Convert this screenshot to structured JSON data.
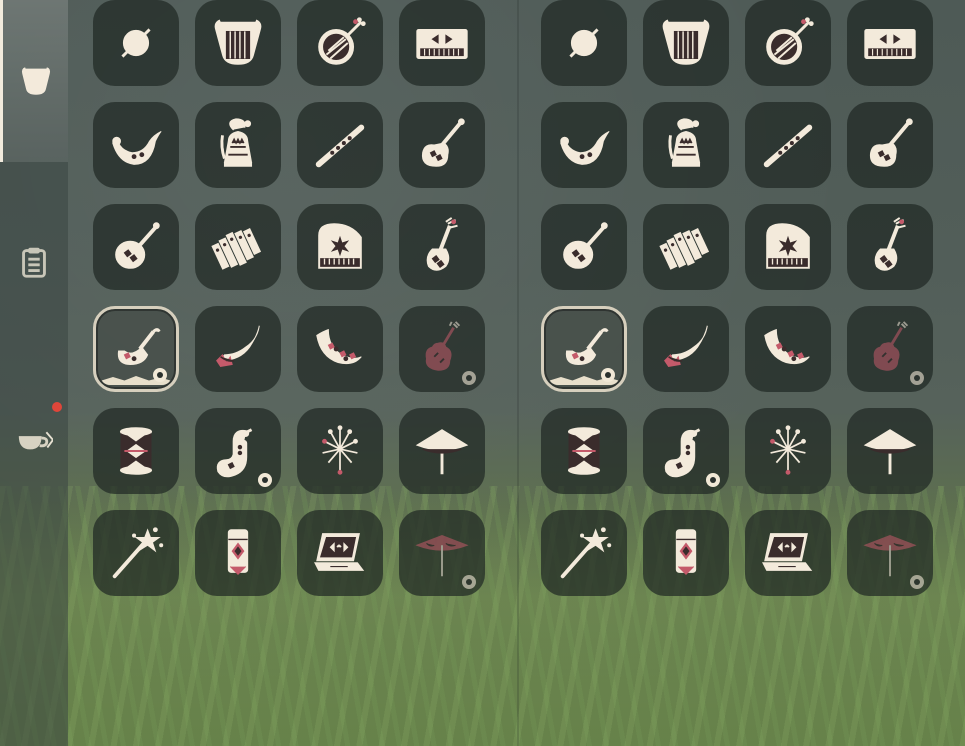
{
  "sidebar": {
    "tabs": [
      {
        "name": "instruments-tab",
        "icon": "lyre-icon",
        "active": true
      },
      {
        "name": "clipboard-tab",
        "icon": "clipboard-icon",
        "active": false
      },
      {
        "name": "teacup-tab",
        "icon": "teacup-icon",
        "active": false,
        "notification": true
      }
    ]
  },
  "instruments": [
    {
      "icon": "none-icon"
    },
    {
      "icon": "lyre-icon"
    },
    {
      "icon": "banjo-icon"
    },
    {
      "icon": "keyboard-icon"
    },
    {
      "icon": "horn-icon"
    },
    {
      "icon": "bell-icon"
    },
    {
      "icon": "flute-icon"
    },
    {
      "icon": "guitar-icon"
    },
    {
      "icon": "mandolin-icon"
    },
    {
      "icon": "xylophone-icon"
    },
    {
      "icon": "piano-icon"
    },
    {
      "icon": "pipa-icon"
    },
    {
      "icon": "ocarina-icon",
      "selected": true
    },
    {
      "icon": "pan-horn-icon"
    },
    {
      "icon": "moon-ocarina-icon"
    },
    {
      "icon": "cello-icon",
      "locked": true
    },
    {
      "icon": "drum-icon"
    },
    {
      "icon": "saxophone-icon",
      "marked": true
    },
    {
      "icon": "sparkler-icon"
    },
    {
      "icon": "umbrella-icon"
    },
    {
      "icon": "magic-wand-icon"
    },
    {
      "icon": "lantern-icon"
    },
    {
      "icon": "laptop-icon"
    },
    {
      "icon": "parasol-icon",
      "locked": true
    }
  ],
  "colors": {
    "icon": "#f3eadb",
    "accent": "#c45a6a",
    "badge": "#e0463a"
  }
}
